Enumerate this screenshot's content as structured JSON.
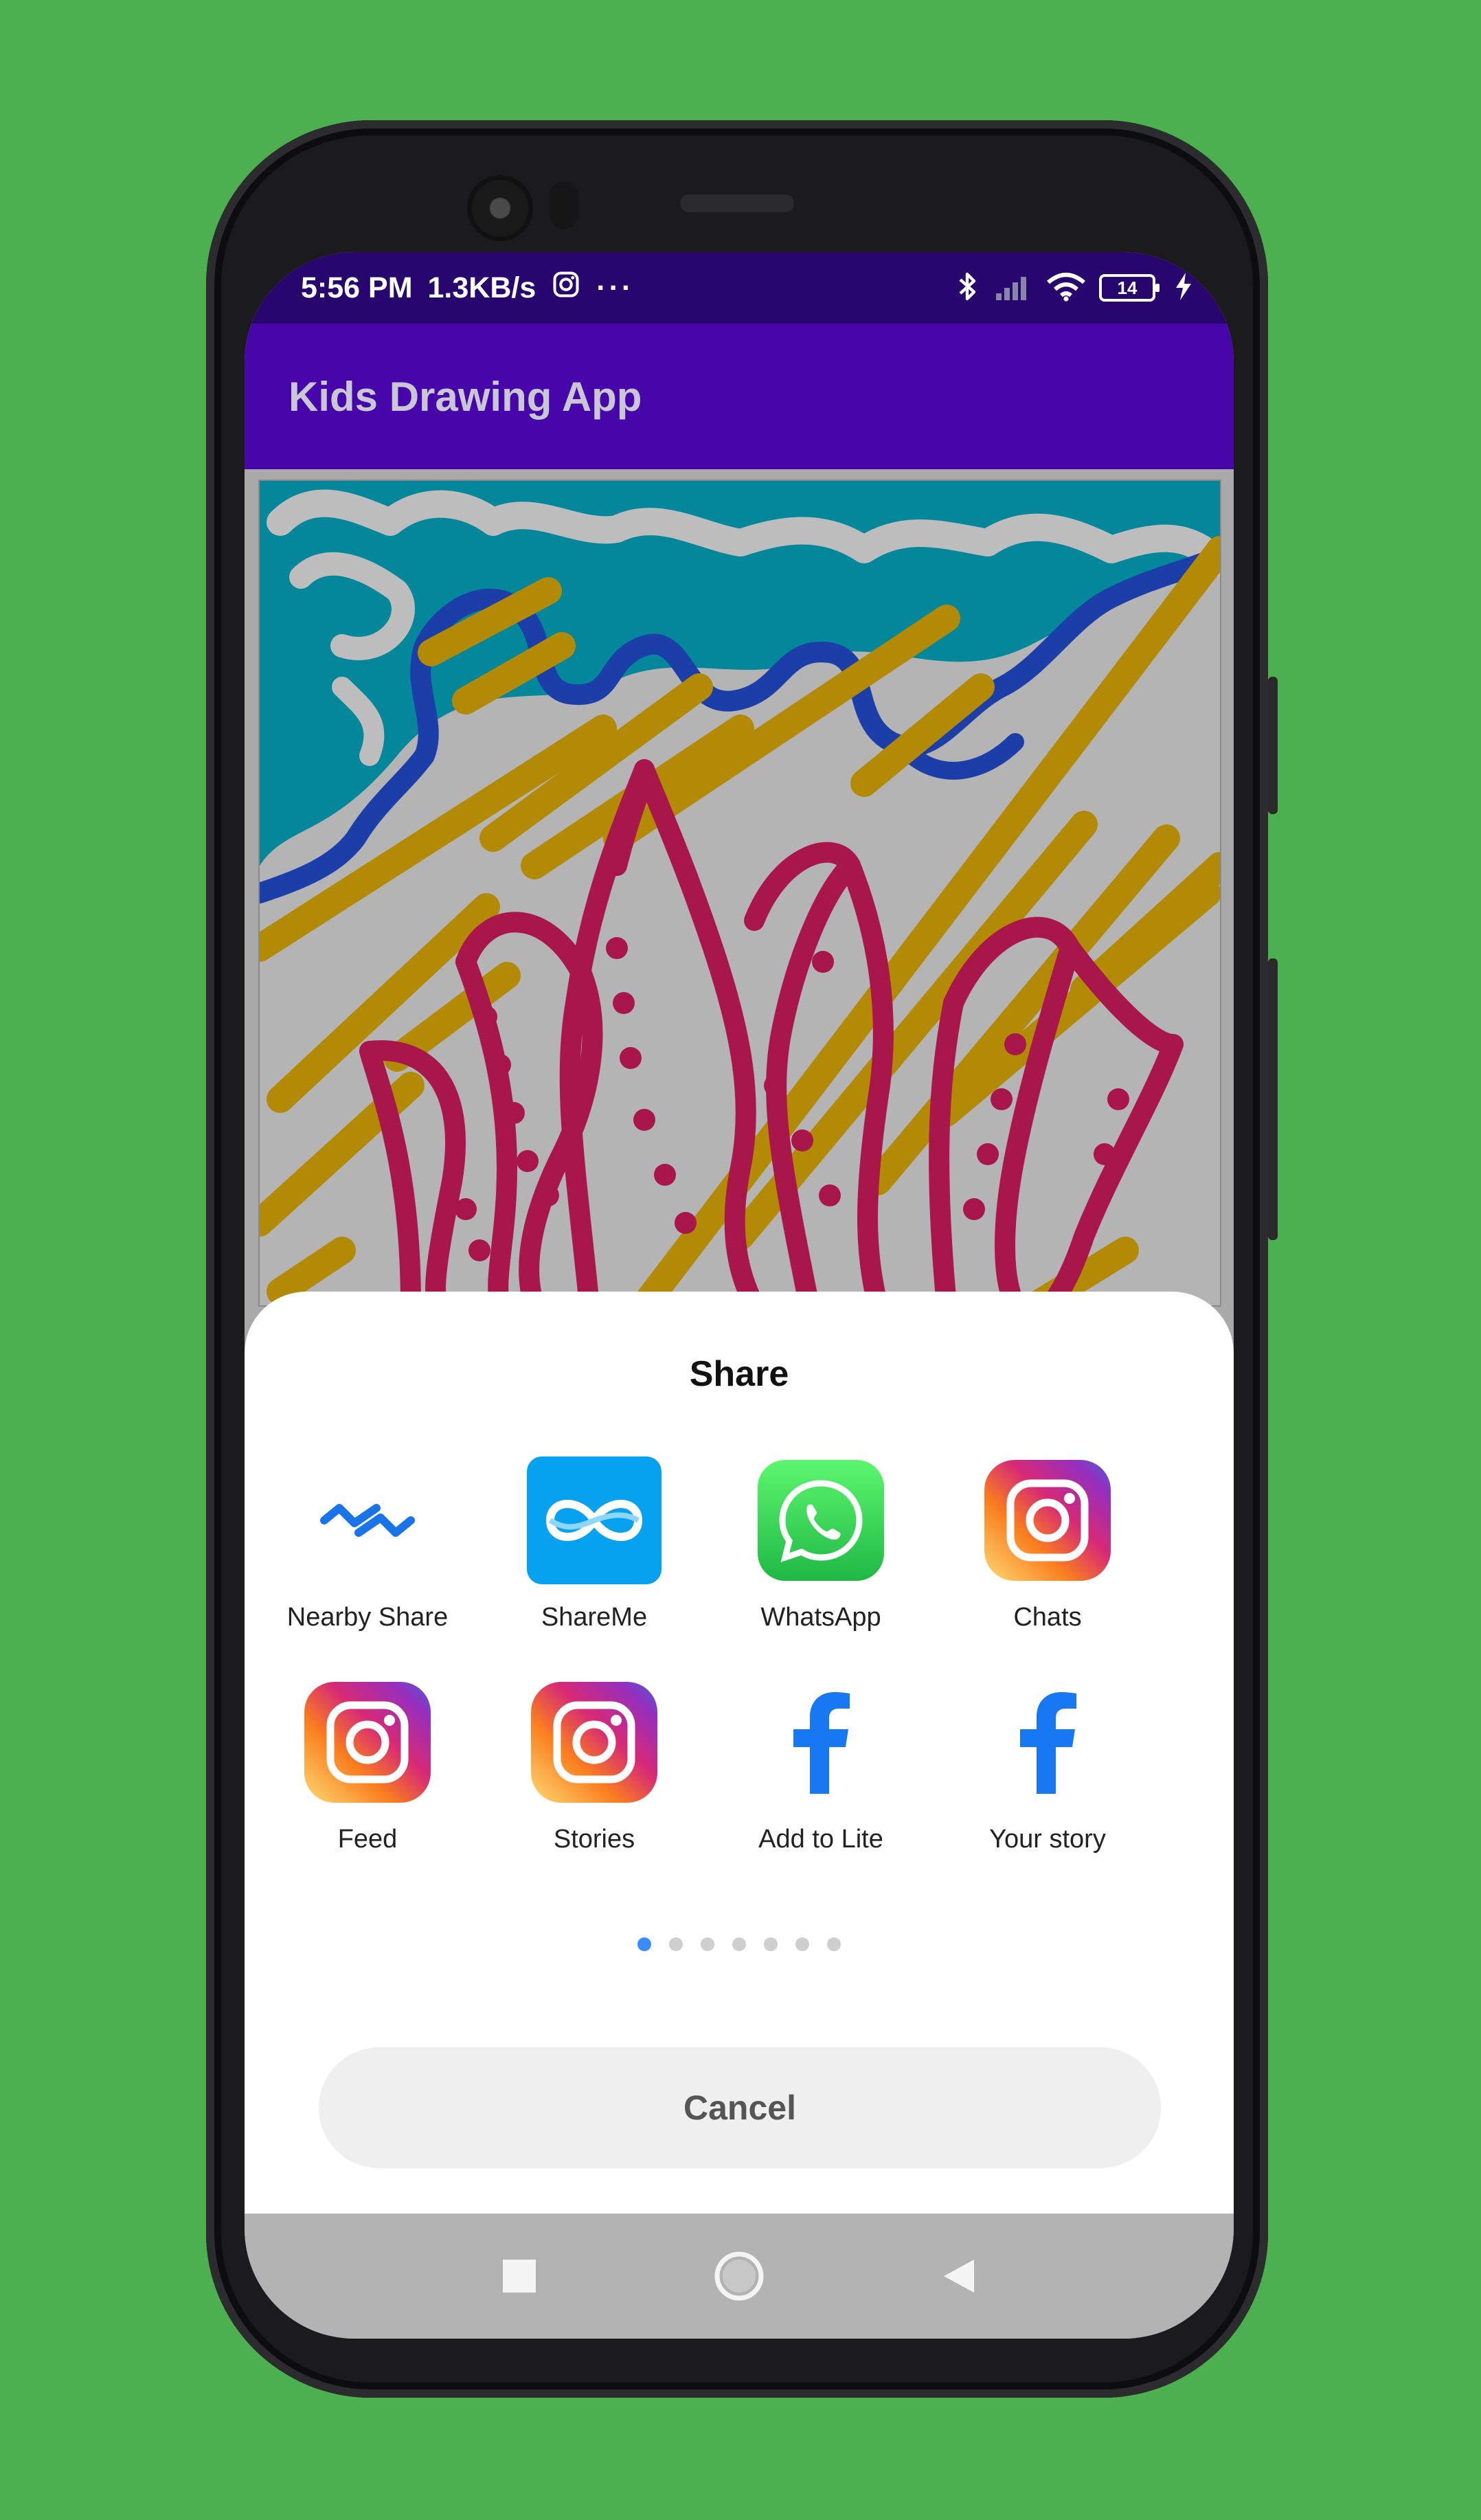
{
  "status_bar": {
    "time": "5:56 PM",
    "speed": "1.3KB/s",
    "more": "···",
    "battery": "14"
  },
  "app": {
    "title": "Kids Drawing App"
  },
  "share_sheet": {
    "title": "Share",
    "apps": [
      {
        "label": "Nearby Share",
        "icon": "nearby-share-icon"
      },
      {
        "label": "ShareMe",
        "icon": "shareme-icon"
      },
      {
        "label": "WhatsApp",
        "icon": "whatsapp-icon"
      },
      {
        "label": "Chats",
        "icon": "instagram-icon"
      },
      {
        "label": "Feed",
        "icon": "instagram-icon"
      },
      {
        "label": "Stories",
        "icon": "instagram-icon"
      },
      {
        "label": "Add to Lite",
        "icon": "facebook-icon"
      },
      {
        "label": "Your story",
        "icon": "facebook-icon"
      }
    ],
    "page_count": 7,
    "active_page": 1,
    "cancel_label": "Cancel"
  },
  "colors": {
    "background": "#4caf50",
    "status_bar": "#27066e",
    "app_bar": "#4606a9",
    "active_dot": "#3a8dff",
    "ink_teal": "#05879b",
    "ink_blue": "#1b3ea8",
    "ink_gold": "#b38a06",
    "ink_crimson": "#a8164a"
  }
}
